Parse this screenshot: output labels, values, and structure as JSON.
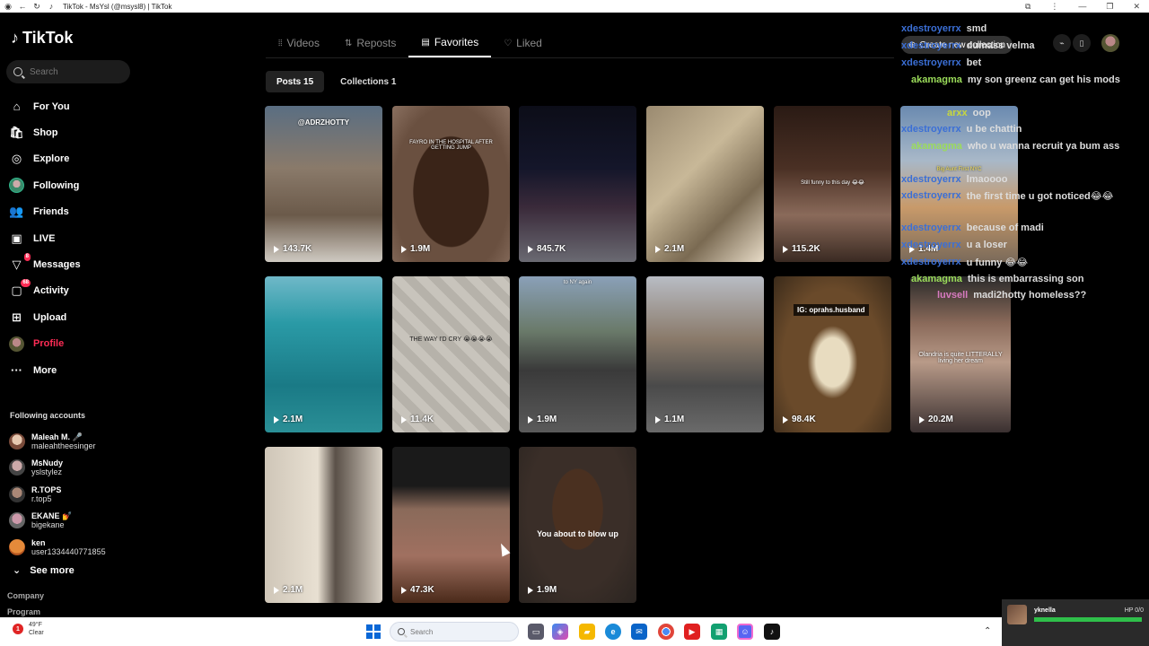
{
  "browser": {
    "tab_title": "TikTok - MsYsl (@msysl8) | TikTok"
  },
  "sidebar": {
    "logo": "TikTok",
    "search_placeholder": "Search",
    "nav": [
      {
        "label": "For You",
        "icon": "home-icon"
      },
      {
        "label": "Shop",
        "icon": "shop-icon"
      },
      {
        "label": "Explore",
        "icon": "compass-icon"
      },
      {
        "label": "Following",
        "icon": "following-avatar-icon"
      },
      {
        "label": "Friends",
        "icon": "friends-icon"
      },
      {
        "label": "LIVE",
        "icon": "live-icon"
      },
      {
        "label": "Messages",
        "icon": "messages-icon",
        "badge": "8"
      },
      {
        "label": "Activity",
        "icon": "activity-icon",
        "badge": "68"
      },
      {
        "label": "Upload",
        "icon": "upload-icon"
      },
      {
        "label": "Profile",
        "icon": "profile-avatar-icon",
        "active": true
      },
      {
        "label": "More",
        "icon": "more-icon"
      }
    ],
    "following_title": "Following accounts",
    "accounts": [
      {
        "name": "Maleah M. 🎤",
        "handle": "maleahtheesinger"
      },
      {
        "name": "MsNudy",
        "handle": "yslstylez"
      },
      {
        "name": "R.TOPS",
        "handle": "r.top5"
      },
      {
        "name": "EKANE 💅",
        "handle": "bigekane"
      },
      {
        "name": "ken",
        "handle": "user1334440771855"
      }
    ],
    "see_more": "See more",
    "footer": [
      "Company",
      "Program"
    ]
  },
  "profile": {
    "tabs": [
      {
        "label": "Videos",
        "icon": "grid-icon"
      },
      {
        "label": "Reposts",
        "icon": "repost-icon"
      },
      {
        "label": "Favorites",
        "icon": "bookmark-icon",
        "active": true
      },
      {
        "label": "Liked",
        "icon": "heart-icon"
      }
    ],
    "segments": [
      {
        "label": "Posts 15",
        "active": true
      },
      {
        "label": "Collections 1",
        "active": false
      }
    ],
    "create_collection": "Create new collection"
  },
  "videos": [
    {
      "views": "143.7K",
      "overlay": "@ADRZHOTTY"
    },
    {
      "views": "1.9M",
      "overlay": "FAYRO IN THE HOSPITAL AFTER GETTING JUMP"
    },
    {
      "views": "845.7K",
      "overlay": ""
    },
    {
      "views": "2.1M",
      "overlay": ""
    },
    {
      "views": "115.2K",
      "overlay": "Still funny to this day 😂😂"
    },
    {
      "views": "1.4M",
      "overlay": "Big Aunt First NYC"
    },
    {
      "views": "2.1M",
      "overlay": ""
    },
    {
      "views": "11.4K",
      "overlay": "THE WAY I'D CRY 😭😭😭😭"
    },
    {
      "views": "1.9M",
      "overlay": "to NY again"
    },
    {
      "views": "1.1M",
      "overlay": ""
    },
    {
      "views": "98.4K",
      "overlay": "IG: oprahs.husband"
    },
    {
      "views": "20.2M",
      "overlay": "Olandria is quite LITTERALLY living her dream"
    },
    {
      "views": "2.1M",
      "overlay": ""
    },
    {
      "views": "47.3K",
      "overlay": ""
    },
    {
      "views": "1.9M",
      "overlay": "You about to blow up"
    }
  ],
  "chat": [
    {
      "user": "xdestroyerrx",
      "color": "blue",
      "msg": "smd"
    },
    {
      "user": "xdestroyerrx",
      "color": "blue",
      "msg": "dumass velma"
    },
    {
      "user": "xdestroyerrx",
      "color": "blue",
      "msg": "bet"
    },
    {
      "user": "akamagma",
      "color": "green",
      "msg": "my son greenz can get his mods"
    },
    {
      "user": "arxx",
      "color": "yellow",
      "msg": "oop"
    },
    {
      "user": "xdestroyerrx",
      "color": "blue",
      "msg": "u be chattin"
    },
    {
      "user": "akamagma",
      "color": "green",
      "msg": "who u wanna recruit ya bum ass"
    },
    {
      "user": "xdestroyerrx",
      "color": "blue",
      "msg": "lmaoooo"
    },
    {
      "user": "xdestroyerrx",
      "color": "blue",
      "msg": "the first time u got noticed😂😂"
    },
    {
      "user": "xdestroyerrx",
      "color": "blue",
      "msg": "because of madi"
    },
    {
      "user": "xdestroyerrx",
      "color": "blue",
      "msg": "u a loser"
    },
    {
      "user": "xdestroyerrx",
      "color": "blue",
      "msg": "u funny 😂😂"
    },
    {
      "user": "akamagma",
      "color": "green",
      "msg": "this is embarrassing son"
    },
    {
      "user": "luvsell",
      "color": "pink",
      "msg": "madi2hotty homeless??"
    }
  ],
  "stream_widget": {
    "name": "yknella",
    "hp": "HP 0/0",
    "hp_fraction": 1.0
  },
  "taskbar": {
    "weather_temp": "49°F",
    "weather_desc": "Clear",
    "weather_badge": "1",
    "search_placeholder": "Search"
  }
}
